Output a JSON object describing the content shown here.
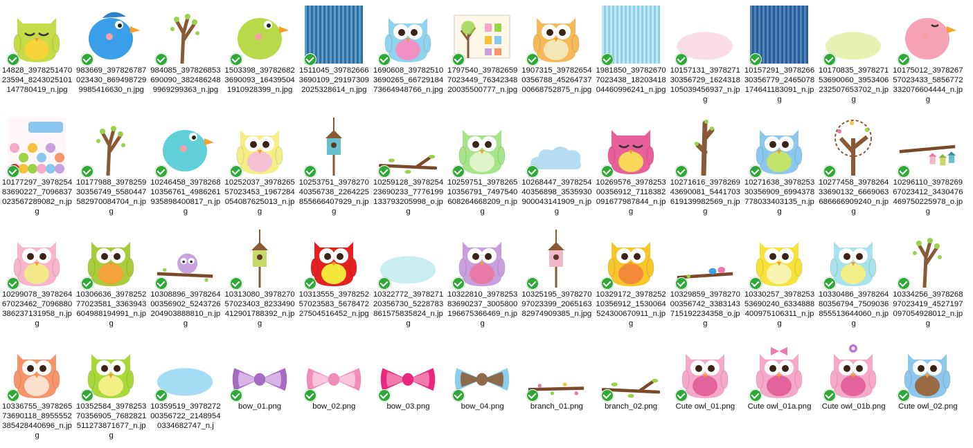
{
  "files": [
    {
      "name": "14828_397825147023594_824302510114 7780419_n.jpg",
      "label": "14828_397825147023594_824302510114​7780419_n.jpg",
      "kind": "owl",
      "c": "#c5dc48",
      "b": "#f5d53a",
      "closed": true
    },
    {
      "name": "983669_397826787023430_8694987299985416630_n.jpg",
      "label": "983669_397826787023430_8694987299985416630_n.jpg",
      "kind": "bird",
      "c": "#3a9ee8",
      "hat": true
    },
    {
      "name": "984085_397826853690090_3824862489969299363_n.jpg",
      "label": "984085_397826853690090_3824862489969299363_n.jpg",
      "kind": "tree"
    },
    {
      "name": "1503398_397826823690093_164395041910928399_n.jpg",
      "label": "1503398_397826823690093_164395041910928399_n.jpg",
      "kind": "bird",
      "c": "#b9d94a"
    },
    {
      "name": "1511045_397826663690109_291973092025328614_n.jpg",
      "label": "1511045_397826663690109_291973092025328614_n.jpg",
      "kind": "stripes",
      "c": "#2d6fa0",
      "c2": "#5d9bc8"
    },
    {
      "name": "1690608_397825103690265_6672918473664948766_n.jpg",
      "label": "1690608_397825103690265_6672918473664948766_n.jpg",
      "kind": "owl",
      "c": "#8fd3ee",
      "b": "#f28fc4"
    },
    {
      "name": "1797540_397826597023449_7634234820035500777_n.jpg",
      "label": "1797540_397826597023449_7634234820035500777_n.jpg",
      "kind": "sheet"
    },
    {
      "name": "1907315_397826540356788_4526473700668752875_n.jpg",
      "label": "1907315_397826540356788_4526473700668752875_n.jpg",
      "kind": "owl",
      "c": "#f5b95a",
      "b": "#f5e6b8"
    },
    {
      "name": "1981850_397826707023438_1820341804460996241_n.jpg",
      "label": "1981850_397826707023438_1820341804460996241_n.jpg",
      "kind": "stripes",
      "c": "#8ed0e8",
      "c2": "#c3e8f4"
    },
    {
      "name": "10157131_397827130356729_1624318105039456937_n.jpg",
      "label": "10157131_397827130356729_1624318105039456937_n.jpg",
      "kind": "bubble",
      "c": "#fadde6"
    },
    {
      "name": "10157291_397826630356779_2465078174641183091_n.jpg",
      "label": "10157291_397826630356779_2465078174641183091_n.jpg",
      "kind": "stripes",
      "c": "#2a5d98",
      "c2": "#4f84bd"
    },
    {
      "name": "10170835_397827153690060_3953406232507653702_n.jpg",
      "label": "10170835_397827153690060_3953406232507653702_n.jpg",
      "kind": "bubble",
      "c": "#e6f1b4"
    },
    {
      "name": "10175012_397826757023433_5856772332076604444_n.jpg",
      "label": "10175012_397826757023433_5856772332076604444_n.jpg",
      "kind": "bird",
      "c": "#f6a3b8",
      "closed": true
    },
    {
      "name": "10177297_397825483690227_7096837023567289082_n.jpg",
      "label": "10177297_397825483690227_7096837023567289082_n.jpg",
      "kind": "banner"
    },
    {
      "name": "10177988_397825930356749_5580447582970084704_n.jpg",
      "label": "10177988_397825930356749_5580447582970084704_n.jpg",
      "kind": "tree"
    },
    {
      "name": "10246458_397826810356761_4986261935898400817_n.jpg",
      "label": "10246458_397826810356761_4986261935898400817_n.jpg",
      "kind": "bird",
      "c": "#5fcfd8"
    },
    {
      "name": "10252037_397826557023453_1967284054087625013_n.jpg",
      "label": "10252037_397826557023453_1967284054087625013_n.jpg",
      "kind": "owl",
      "c": "#f3ef86",
      "b": "#f6c0d4"
    },
    {
      "name": "10253751_397827040356738_2264225855666407929_n.jpg",
      "label": "10253751_397827040356738_2264225855666407929_n.jpg",
      "kind": "birdhouse",
      "c": "#68c0cc"
    },
    {
      "name": "10259128_397825423690233_7776199133793205998_o.jpg",
      "label": "10259128_397825423690233_7776199133793205998_o.jpg",
      "kind": "branch"
    },
    {
      "name": "10259751_397826510356791_7497540608264668209_n.jpg",
      "label": "10259751_397826510356791_7497540608264668209_n.jpg",
      "kind": "owl",
      "c": "#a6e38a",
      "b": "#dff2c8"
    },
    {
      "name": "10268447_397825440356898_3535930900043141909_n.jpg",
      "label": "10268447_397825440356898_3535930900043141909_n.jpg",
      "kind": "cloud",
      "c": "#b5dcf0"
    },
    {
      "name": "10269576_397825300356912_7118382091677987844_n.jpg",
      "label": "10269576_397825300356912_7118382091677987844_n.jpg",
      "kind": "owl",
      "c": "#e8609a",
      "b": "#f7d85a",
      "closed": true
    },
    {
      "name": "10271616_397826943690081_5441703619139982569_n.jpg",
      "label": "10271616_397826943690081_5441703619139982569_n.jpg",
      "kind": "trunk"
    },
    {
      "name": "10271638_397825330356909_6994378778033403135_n.jpg",
      "label": "10271638_397825330356909_6994378778033403135_n.jpg",
      "kind": "owl",
      "c": "#8cc8ee",
      "b": "#c3e36a"
    },
    {
      "name": "10277458_397826433690132_6669063686666909240_n.jpg",
      "label": "10277458_397826433690132_6669063686666909240_n.jpg",
      "kind": "tree2"
    },
    {
      "name": "10296110_397826967023412_3430476469750225978_o.jpg",
      "label": "10296110_397826967023412_3430476469750225978_o.jpg",
      "kind": "branchhouses"
    },
    {
      "name": "10299078_397826467023462_7096880386237131958_n.jpg",
      "label": "10299078_397826467023462_7096880386237131958_n.jpg",
      "kind": "owl",
      "c": "#f7b6cc",
      "b": "#f4e98a"
    },
    {
      "name": "10306636_397825277023581_3363943604988194991_n.jpg",
      "label": "10306636_397825277023581_3363943604988194991_n.jpg",
      "kind": "owl",
      "c": "#a8cc3c",
      "b": "#f3a23a"
    },
    {
      "name": "10308896_397826400356902_5243726204903888810_n.jpg",
      "label": "10308896_397826400356902_5243726204903888810_n.jpg",
      "kind": "owlbranch",
      "c": "#c9a3e0"
    },
    {
      "name": "10313080_397827057023403_8233490412901788392_n.jpg",
      "label": "10313080_397827057023403_8233490412901788392_n.jpg",
      "kind": "birdhouse",
      "c": "#c8d96a"
    },
    {
      "name": "10313555_397825257023583_567847227504516452_n.jpg",
      "label": "10313555_397825257023583_567847227504516452_n.jpg",
      "kind": "owl",
      "c": "#e42020",
      "b": "#f3e63a"
    },
    {
      "name": "10322772_397827120356730_5228783861575835824_n.jpg",
      "label": "10322772_397827120356730_5228783861575835824_n.jpg",
      "kind": "bubble",
      "c": "#c8eef0"
    },
    {
      "name": "10322810_397825383690237_3005800196675366469_n.jpg",
      "label": "10322810_397825383690237_3005800196675366469_n.jpg",
      "kind": "owl",
      "c": "#c7a0dc",
      "b": "#e87aa8"
    },
    {
      "name": "10325195_397827097023399_206516382974909385_n.jpg",
      "label": "10325195_397827097023399_206516382974909385_n.jpg",
      "kind": "birdhouse",
      "c": "#f2b8c8"
    },
    {
      "name": "10329172_397825210356912_1530064524300670911_n.jpg",
      "label": "10329172_397825210356912_1530064524300670911_n.jpg",
      "kind": "owl",
      "c": "#f7c62a",
      "b": "#f38a3a"
    },
    {
      "name": "10329859_397827000356742_3383143715192234358_o.jpg",
      "label": "10329859_397827000356742_3383143715192234358_o.jpg",
      "kind": "branchbirds"
    },
    {
      "name": "10330257_397825353690240_6334888400975106311_n.jpg",
      "label": "10330257_397825353690240_6334888400975106311_n.jpg",
      "kind": "owl",
      "c": "#f7e23a",
      "b": "#f7f3b0"
    },
    {
      "name": "10330486_397826480356794_7509036855513644060_n.jpg",
      "label": "10330486_397826480356794_7509036855513644060_n.jpg",
      "kind": "owl",
      "c": "#a8e2ea",
      "b": "#f3ef86"
    },
    {
      "name": "10334256_397826897023419_4527197097054928012_n.jpg",
      "label": "10334256_397826897023419_4527197097054928012_n.jpg",
      "kind": "tree"
    },
    {
      "name": "10336755_397826573690118_8955552385428440696_n.jpg",
      "label": "10336755_397826573690118_8955552385428440696_n.jpg",
      "kind": "owl",
      "c": "#f6946a",
      "b": "#fbe0cc"
    },
    {
      "name": "10352584_397825370356905_7682821511273871677_n.jpg",
      "label": "10352584_397825370356905_7682821511273871677_n.jpg",
      "kind": "owl",
      "c": "#a8d83a",
      "b": "#f3ef86"
    },
    {
      "name": "10359519_397827200356722_21489540334682747_n.jpg",
      "label": "10359519_397827200356722_21489540334682747_n.j",
      "kind": "bubble",
      "c": "#a6dcf4"
    },
    {
      "name": "bow_01.png",
      "label": "bow_01.png",
      "kind": "bow",
      "c": "#a66cc0",
      "c2": "#d8b4e6"
    },
    {
      "name": "bow_02.png",
      "label": "bow_02.png",
      "kind": "bow",
      "c": "#f08cb8",
      "c2": "#f8c6dc"
    },
    {
      "name": "bow_03.png",
      "label": "bow_03.png",
      "kind": "bow",
      "c": "#e8287c",
      "c2": "#f37aac"
    },
    {
      "name": "bow_04.png",
      "label": "bow_04.png",
      "kind": "bow",
      "c": "#8ccfea",
      "c2": "#8c6a4a"
    },
    {
      "name": "branch_01.png",
      "label": "branch_01.png",
      "kind": "branchflowers"
    },
    {
      "name": "branch_02.png",
      "label": "branch_02.png",
      "kind": "branch"
    },
    {
      "name": "Cute owl_01.png",
      "label": "Cute owl_01.png",
      "kind": "owl",
      "c": "#f5a8c8",
      "b": "#e2649a"
    },
    {
      "name": "Cute owl_01a.png",
      "label": "Cute owl_01a.png",
      "kind": "owl",
      "c": "#f5a8c8",
      "b": "#e2649a",
      "bow": true
    },
    {
      "name": "Cute owl_01b.png",
      "label": "Cute owl_01b.png",
      "kind": "owl",
      "c": "#f5a8c8",
      "b": "#e2649a",
      "flower": true
    },
    {
      "name": "Cute owl_02.png",
      "label": "Cute owl_02.png",
      "kind": "owl",
      "c": "#8cc8ee",
      "b": "#9a6a44"
    }
  ]
}
